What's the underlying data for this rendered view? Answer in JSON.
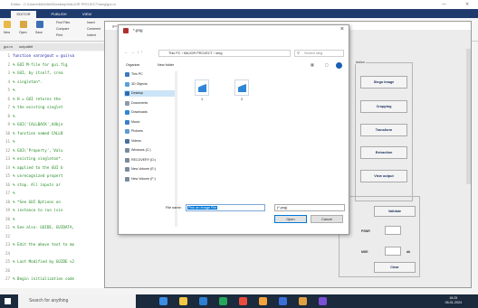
{
  "editor": {
    "title": "Editor - C:\\Users\\MAHAM\\Desktop\\MAJOR PROJECT\\steg\\gui.m",
    "tabs": [
      "EDITOR",
      "PUBLISH",
      "VIEW"
    ],
    "ribbon": {
      "new": "New",
      "open": "Open",
      "save": "Save",
      "find_files": "Find Files",
      "compare": "Compare",
      "print": "Print",
      "insert": "Insert",
      "comment": "Comment",
      "indent": "Indent"
    },
    "file_tabs": [
      "gui.m",
      "outputbit"
    ],
    "lines": [
      {
        "n": "1",
        "text": "function varargout = gui(va",
        "kw": true
      },
      {
        "n": "2",
        "text": "% GUI M-file for gui.fig",
        "kw": false
      },
      {
        "n": "3",
        "text": "%      GUI, by itself, crea",
        "kw": false
      },
      {
        "n": "4",
        "text": "%      singleton*.",
        "kw": false
      },
      {
        "n": "5",
        "text": "%",
        "kw": false
      },
      {
        "n": "6",
        "text": "%      H = GUI returns the",
        "kw": false
      },
      {
        "n": "7",
        "text": "%      the existing singlet",
        "kw": false
      },
      {
        "n": "8",
        "text": "%",
        "kw": false
      },
      {
        "n": "9",
        "text": "%      GUI('CALLBACK',hObje",
        "kw": false
      },
      {
        "n": "10",
        "text": "%      function named CALLB",
        "kw": false
      },
      {
        "n": "11",
        "text": "%",
        "kw": false
      },
      {
        "n": "12",
        "text": "%      GUI('Property','Valu",
        "kw": false
      },
      {
        "n": "13",
        "text": "%      existing singleton*.",
        "kw": false
      },
      {
        "n": "14",
        "text": "%      applied to the GUI b",
        "kw": false
      },
      {
        "n": "15",
        "text": "%      unrecognized propert",
        "kw": false
      },
      {
        "n": "16",
        "text": "%      stop.  All inputs ar",
        "kw": false
      },
      {
        "n": "17",
        "text": "%",
        "kw": false
      },
      {
        "n": "18",
        "text": "%      *See GUI Options on",
        "kw": false
      },
      {
        "n": "19",
        "text": "%      instance to run (sin",
        "kw": false
      },
      {
        "n": "20",
        "text": "%",
        "kw": false
      },
      {
        "n": "21",
        "text": "% See also: GUIDE, GUIDATA,",
        "kw": false
      },
      {
        "n": "22",
        "text": "",
        "kw": false
      },
      {
        "n": "23",
        "text": "% Edit the above text to mo",
        "kw": false
      },
      {
        "n": "24",
        "text": "",
        "kw": false
      },
      {
        "n": "25",
        "text": "% Last Modified by GUIDE v2",
        "kw": false
      },
      {
        "n": "26",
        "text": "",
        "kw": false
      },
      {
        "n": "27",
        "text": "% Begin initialization code",
        "kw": false
      }
    ]
  },
  "figure": {
    "title": "gui",
    "action_panel_title": "Action",
    "buttons": [
      "Stego Image",
      "Cropping",
      "Transform",
      "Extraction",
      "View output"
    ],
    "results_panel_title": "Metrics",
    "validate": "Validate",
    "psnr_label": "PSNR",
    "mse_label": "MSE",
    "db_label": "db",
    "clear": "Clear"
  },
  "dialog": {
    "title": "*.png",
    "path": [
      "This PC",
      "MAJOR PROJECT",
      "steg"
    ],
    "search_placeholder": "Search steg",
    "organize": "Organize",
    "new_folder": "New folder",
    "nav_items": [
      {
        "label": "This PC",
        "color": "#3b7bbf"
      },
      {
        "label": "3D Objects",
        "color": "#56a0e0"
      },
      {
        "label": "Desktop",
        "color": "#2b6cb0",
        "selected": true
      },
      {
        "label": "Documents",
        "color": "#8d9aa8"
      },
      {
        "label": "Downloads",
        "color": "#2f86d8"
      },
      {
        "label": "Music",
        "color": "#3a7fcf"
      },
      {
        "label": "Pictures",
        "color": "#5e9bd6"
      },
      {
        "label": "Videos",
        "color": "#4a6ea0"
      },
      {
        "label": "Windows (C:)",
        "color": "#7a8b9c"
      },
      {
        "label": "RECOVERY (D:)",
        "color": "#7a8b9c"
      },
      {
        "label": "New Volume (E:)",
        "color": "#7a8b9c"
      },
      {
        "label": "New Volume (F:)",
        "color": "#7a8b9c"
      }
    ],
    "files": [
      {
        "name": "1"
      },
      {
        "name": "2"
      }
    ],
    "file_name_label": "File name:",
    "file_name_value": "Pick an Image File",
    "file_type": "(*.png)",
    "open": "Open",
    "cancel": "Cancel"
  },
  "taskbar": {
    "search_placeholder": "Search for anything",
    "time": "18:25",
    "date": "06-01-2024",
    "icons": [
      "#3a8ee6",
      "#f3c744",
      "#2d7fd3",
      "#26a65b",
      "#e84c3d",
      "#f2a33a",
      "#3b6fd8",
      "#e0a040",
      "#7a4fd6"
    ]
  }
}
